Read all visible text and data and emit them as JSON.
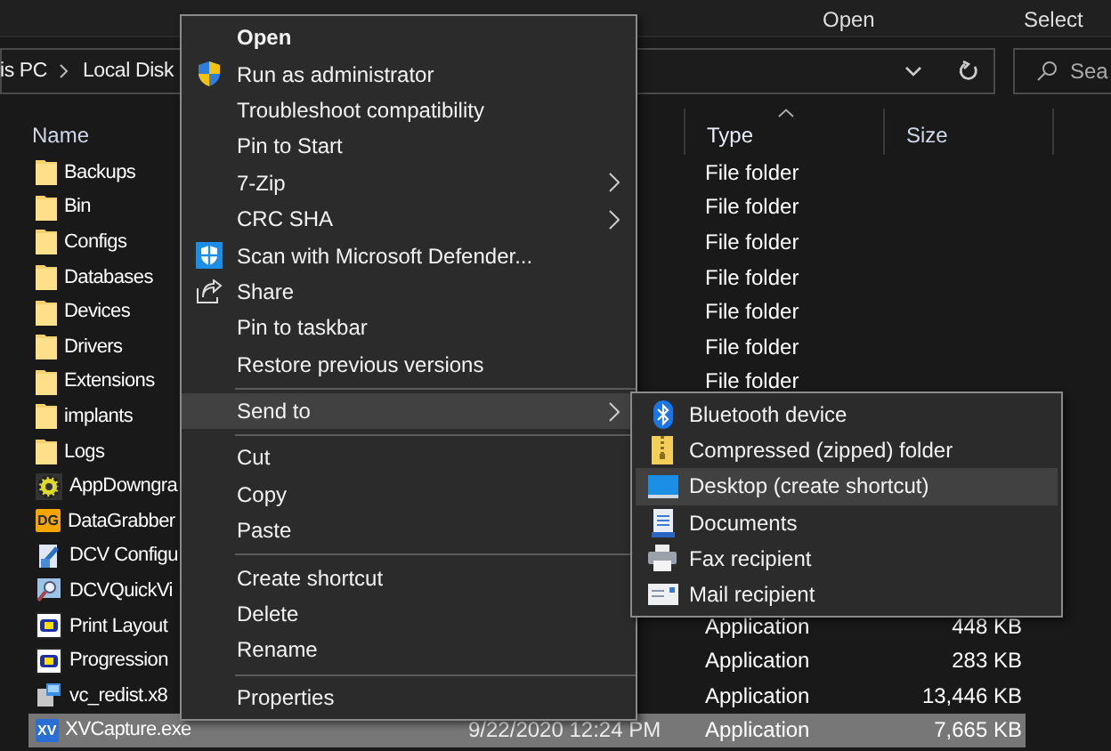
{
  "ribbon": {
    "groups": [
      {
        "label": "Open"
      },
      {
        "label": "Select"
      }
    ]
  },
  "address_bar": {
    "path": [
      "is PC",
      "Local Disk"
    ]
  },
  "search": {
    "placeholder": "Sea"
  },
  "file_list": {
    "columns": [
      {
        "label": "Name",
        "sorted": false
      },
      {
        "label": "Type",
        "sorted": true
      },
      {
        "label": "Size",
        "sorted": false
      }
    ],
    "rows": [
      {
        "name": "Backups",
        "kind": "folder",
        "type": "File folder",
        "selected": false
      },
      {
        "name": "Bin",
        "kind": "folder",
        "type": "File folder",
        "selected": false
      },
      {
        "name": "Configs",
        "kind": "folder",
        "type": "File folder",
        "selected": false
      },
      {
        "name": "Databases",
        "kind": "folder",
        "type": "File folder",
        "selected": false
      },
      {
        "name": "Devices",
        "kind": "folder",
        "type": "File folder",
        "selected": false
      },
      {
        "name": "Drivers",
        "kind": "folder",
        "type": "File folder",
        "selected": false
      },
      {
        "name": "Extensions",
        "kind": "folder",
        "type": "File folder",
        "selected": false
      },
      {
        "name": "implants",
        "kind": "folder",
        "selected": false
      },
      {
        "name": "Logs",
        "kind": "folder",
        "selected": false
      },
      {
        "name": "AppDowngra",
        "kind": "gear",
        "selected": false
      },
      {
        "name": "DataGrabber",
        "kind": "badge",
        "badge": "DG",
        "selected": false
      },
      {
        "name": "DCV Configu",
        "kind": "config",
        "selected": false
      },
      {
        "name": "DCVQuickVi",
        "kind": "viewer",
        "selected": false
      },
      {
        "name": "Print Layout",
        "kind": "d-app",
        "type": "Application",
        "size": "448 KB",
        "selected": false
      },
      {
        "name": "Progression",
        "kind": "d-app",
        "type": "Application",
        "size": "283 KB",
        "selected": false
      },
      {
        "name": "vc_redist.x8",
        "kind": "installer",
        "type": "Application",
        "size": "13,446 KB",
        "selected": false
      },
      {
        "name": "XVCapture.exe",
        "kind": "badge",
        "badge": "XV",
        "date": "9/22/2020 12:24 PM",
        "type": "Application",
        "size": "7,665 KB",
        "selected": true
      }
    ]
  },
  "context_menu": {
    "items": [
      {
        "kind": "plain",
        "label": "Open",
        "default": true,
        "selected": false
      },
      {
        "kind": "shield",
        "label": "Run as administrator",
        "selected": false
      },
      {
        "kind": "plain",
        "label": "Troubleshoot compatibility",
        "selected": false
      },
      {
        "kind": "plain",
        "label": "Pin to Start",
        "selected": false
      },
      {
        "kind": "plain",
        "label": "7-Zip",
        "submenu": true,
        "selected": false
      },
      {
        "kind": "plain",
        "label": "CRC SHA",
        "submenu": true,
        "selected": false
      },
      {
        "kind": "defender",
        "label": "Scan with Microsoft Defender...",
        "selected": false
      },
      {
        "kind": "share",
        "label": "Share",
        "selected": false
      },
      {
        "kind": "plain",
        "label": "Pin to taskbar",
        "selected": false
      },
      {
        "kind": "plain",
        "label": "Restore previous versions",
        "selected": false
      },
      {
        "kind": "separator"
      },
      {
        "kind": "plain",
        "label": "Send to",
        "submenu": true,
        "selected": true
      },
      {
        "kind": "separator"
      },
      {
        "kind": "plain",
        "label": "Cut",
        "selected": false
      },
      {
        "kind": "plain",
        "label": "Copy",
        "selected": false
      },
      {
        "kind": "plain",
        "label": "Paste",
        "selected": false
      },
      {
        "kind": "separator"
      },
      {
        "kind": "plain",
        "label": "Create shortcut",
        "selected": false
      },
      {
        "kind": "plain",
        "label": "Delete",
        "selected": false
      },
      {
        "kind": "plain",
        "label": "Rename",
        "selected": false
      },
      {
        "kind": "separator"
      },
      {
        "kind": "plain",
        "label": "Properties",
        "selected": false
      }
    ]
  },
  "send_to_menu": {
    "items": [
      {
        "label": "Bluetooth device",
        "kind": "bluetooth",
        "selected": false
      },
      {
        "label": "Compressed (zipped) folder",
        "kind": "zip",
        "selected": false
      },
      {
        "label": "Desktop (create shortcut)",
        "kind": "desktop",
        "selected": true
      },
      {
        "label": "Documents",
        "kind": "document",
        "selected": false
      },
      {
        "label": "Fax recipient",
        "kind": "printer",
        "selected": false
      },
      {
        "label": "Mail recipient",
        "kind": "mail",
        "selected": false
      }
    ]
  }
}
